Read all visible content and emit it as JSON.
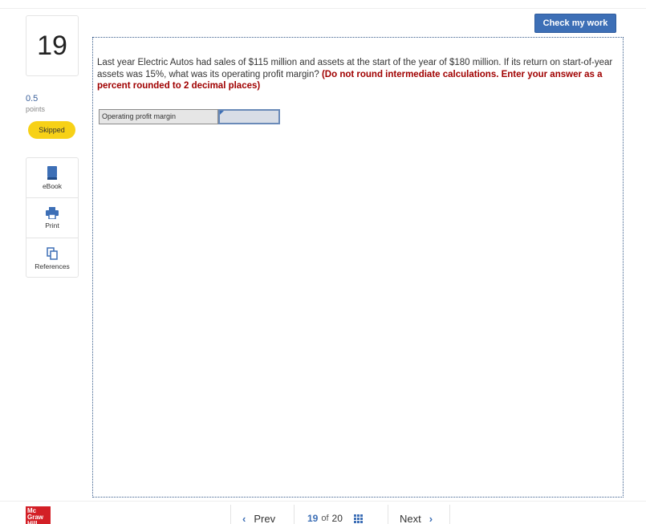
{
  "header": {
    "check_label": "Check my work"
  },
  "question": {
    "number": "19",
    "points_value": "0.5",
    "points_label": "points",
    "status": "Skipped",
    "text": "Last year Electric Autos had sales of $115 million and assets at the start of the year of $180 million. If its return on start-of-year assets was 15%, what was its operating profit margin? ",
    "instruction": "(Do not round intermediate calculations. Enter your answer as a percent rounded to 2 decimal places)"
  },
  "tools": [
    {
      "label": "eBook",
      "icon": "book-icon"
    },
    {
      "label": "Print",
      "icon": "printer-icon"
    },
    {
      "label": "References",
      "icon": "documents-icon"
    }
  ],
  "answer": {
    "label": "Operating profit margin",
    "value": ""
  },
  "footer": {
    "logo_text": "Mc Graw Hill",
    "prev_label": "Prev",
    "next_label": "Next",
    "current": "19",
    "of_label": "of",
    "total": "20"
  },
  "colors": {
    "accent": "#3d6fb6",
    "skipped": "#f7d117",
    "brand_red": "#d31f26",
    "instruction_red": "#a00000"
  }
}
